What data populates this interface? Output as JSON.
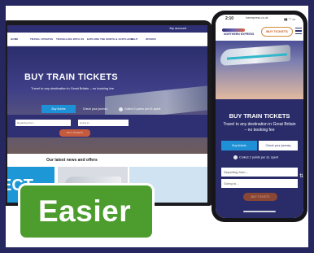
{
  "laptop": {
    "account_label": "My account",
    "nav": [
      "HOME",
      "TRAVEL UPDATES",
      "TRAVELLING WITH US",
      "EXPLORE THE NORTH & SCOTLAND",
      "HELP",
      "OFFERS"
    ],
    "hero_title": "BUY TRAIN TICKETS",
    "hero_subtitle": "Travel to any destination in Great Britain – no booking fee",
    "tabs": [
      "Buy tickets",
      "Check your journey"
    ],
    "points_text": "Collect 2 points per £1 spent",
    "from_placeholder": "Departing from...",
    "to_placeholder": "Going to...",
    "submit_label": "BUY TICKETS",
    "news_title": "Our latest news and offers",
    "news_card_text": "ECT"
  },
  "badge": {
    "label": "Easier"
  },
  "phone": {
    "time": "2:10",
    "url": "lnerexpress.co.uk",
    "signal": "▮▮ ◠ ▭",
    "logo_text": "NORTHERN EXPRESS",
    "buy_button": "BUY TICKETS",
    "hero_title": "BUY TRAIN TICKETS",
    "hero_subtitle": "Travel to any destination in Great Britain – no booking fee",
    "tabs": [
      "Buy tickets",
      "Check your journey"
    ],
    "points_text": "Collect 2 points per £1 spent",
    "from_placeholder": "Departing from...",
    "to_placeholder": "Going to...",
    "swap_icon": "⇅",
    "submit_label": "BUY TICKETS"
  }
}
